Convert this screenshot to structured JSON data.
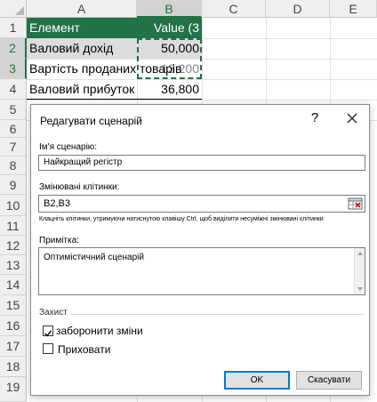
{
  "sheet": {
    "columns": [
      "A",
      "B",
      "C",
      "D",
      "E"
    ],
    "rows": [
      "1",
      "2",
      "3",
      "4",
      "5",
      "6",
      "7",
      "8",
      "9",
      "10",
      "11",
      "12",
      "13",
      "14",
      "15",
      "16",
      "17",
      "18",
      "19"
    ],
    "header_cells": {
      "a1": "Елемент",
      "b1": "Value (3"
    },
    "cells": {
      "a2": "Валовий дохід",
      "b2": "50,000",
      "a3": "Вартість проданих товарів",
      "b3": "13,200",
      "a4": "Валовий прибуток",
      "b4": "36,800"
    },
    "colors": {
      "header_bg": "#217346",
      "accent": "#217346"
    }
  },
  "dialog": {
    "title": "Редагувати сценарій",
    "help_glyph": "?",
    "close_icon": "close-icon",
    "scenario_name_label": "Ім'я сценарію:",
    "scenario_name_value": "Найкращий регістр",
    "changing_cells_label": "Змінювані клітинки:",
    "changing_cells_value": "B2,B3",
    "changing_cells_hint": "Клацніть клітинки, утримуючи натиснутою клавішу Ctrl, щоб виділити несуміжні змінювані клітинки",
    "comment_label": "Примітка:",
    "comment_value": "Оптимістичний сценарій",
    "protection_label": "Захист",
    "prevent_changes_label": "заборонити зміни",
    "prevent_changes_checked": true,
    "hide_label": "Приховати",
    "hide_checked": false,
    "ok_label": "OK",
    "cancel_label": "Скасувати"
  }
}
